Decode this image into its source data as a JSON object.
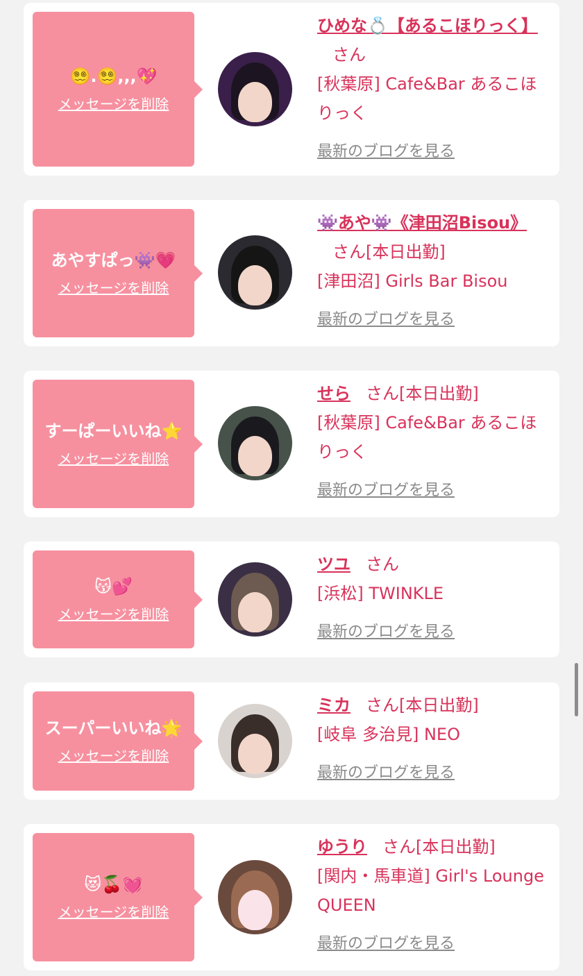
{
  "cards": [
    {
      "message": "😵‍💫.😵‍💫,,,💖",
      "delete_label": "メッセージを削除",
      "name": "ひめな💍【あるこほりっく】",
      "san": "さん",
      "status": "",
      "shop": "[秋葉原] Cafe&Bar あるこほりっく",
      "blog_label": "最新のブログを見る"
    },
    {
      "message": "あやすぱっ👾💗",
      "delete_label": "メッセージを削除",
      "name": "👾あや👾《津田沼Bisou》",
      "san": "さん",
      "status": "[本日出勤]",
      "shop": "[津田沼] Girls Bar Bisou",
      "blog_label": "最新のブログを見る"
    },
    {
      "message": "すーぱーいいね⭐️",
      "delete_label": "メッセージを削除",
      "name": "せら",
      "san": "さん",
      "status": "[本日出勤]",
      "shop": "[秋葉原] Cafe&Bar あるこほりっく",
      "blog_label": "最新のブログを見る"
    },
    {
      "message": "😽💕",
      "delete_label": "メッセージを削除",
      "name": "ツユ",
      "san": "さん",
      "status": "",
      "shop": "[浜松] TWINKLE",
      "blog_label": "最新のブログを見る"
    },
    {
      "message": "スーパーいいね🌟",
      "delete_label": "メッセージを削除",
      "name": "ミカ",
      "san": "さん",
      "status": "[本日出勤]",
      "shop": "[岐阜 多治見] NEO",
      "blog_label": "最新のブログを見る"
    },
    {
      "message": "😻🍒💓",
      "delete_label": "メッセージを削除",
      "name": "ゆうり",
      "san": "さん",
      "status": "[本日出勤]",
      "shop": "[関内・馬車道] Girl's Lounge QUEEN",
      "blog_label": "最新のブログを見る"
    }
  ],
  "colors": {
    "accent": "#d8325a",
    "bubble": "#f6909f",
    "muted": "#8a8a8a",
    "background": "#f2f2f2"
  }
}
